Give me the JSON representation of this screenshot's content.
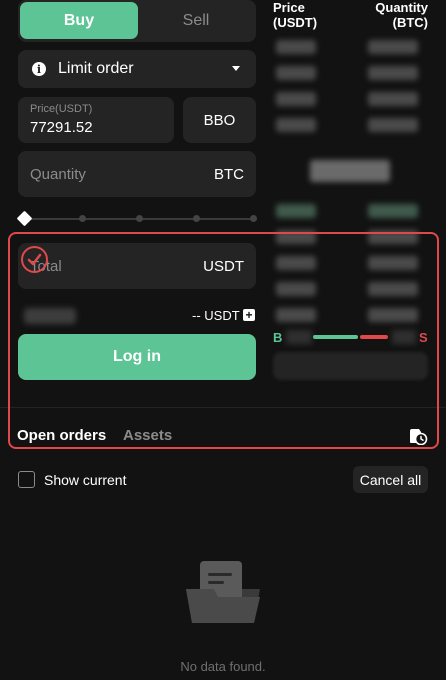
{
  "trade_panel": {
    "buy_label": "Buy",
    "sell_label": "Sell",
    "order_type": "Limit order",
    "price_label": "Price(USDT)",
    "price_value": "77291.52",
    "bbo_label": "BBO",
    "quantity_placeholder": "Quantity",
    "quantity_unit": "BTC",
    "total_placeholder": "Total",
    "total_unit": "USDT",
    "available_text": "-- USDT",
    "login_label": "Log in"
  },
  "order_book": {
    "price_header": "Price\n(USDT)",
    "quantity_header": "Quantity\n(BTC)",
    "buy_marker": "B",
    "sell_marker": "S"
  },
  "orders_section": {
    "tabs": [
      {
        "label": "Open orders",
        "active": true
      },
      {
        "label": "Assets",
        "active": false
      }
    ],
    "show_current_label": "Show current",
    "cancel_all_label": "Cancel all",
    "empty_text": "No data found."
  },
  "colors": {
    "accent_green": "#5dc495",
    "accent_red": "#e0484a",
    "background": "#121212",
    "surface": "#242424"
  }
}
